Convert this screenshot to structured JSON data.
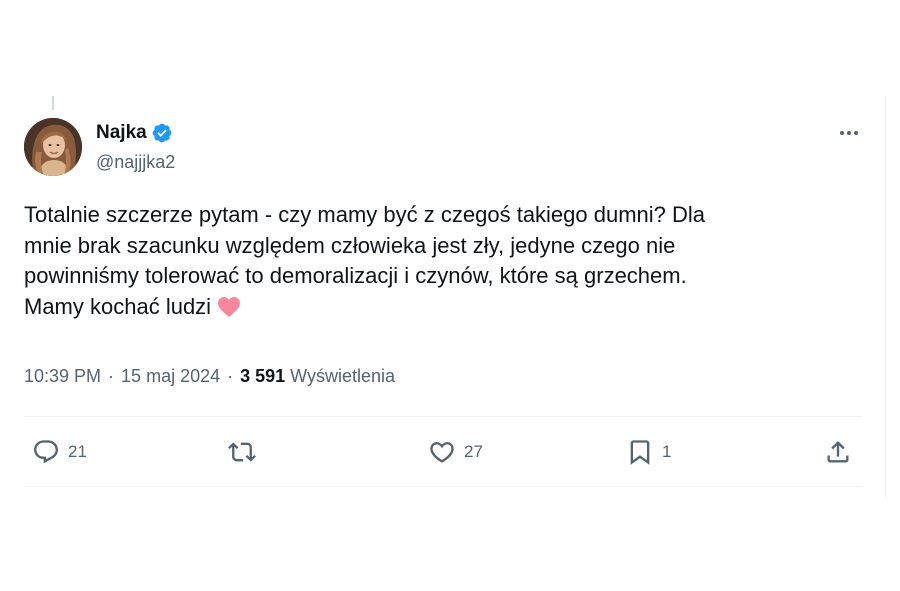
{
  "user": {
    "display_name": "Najka",
    "handle": "@najjjka2",
    "verified_color": "#1d9bf0"
  },
  "tweet": {
    "lines": [
      "Totalnie szczerze pytam - czy mamy być z czegoś takiego dumni? Dla",
      "mnie brak szacunku względem człowieka jest zły, jedyne czego nie",
      "powinniśmy tolerować to demoralizacji i czynów, które są grzechem.",
      "Mamy kochać ludzi"
    ],
    "emoji_name": "pink-heart",
    "emoji_color": "#f7879a"
  },
  "meta": {
    "time": "10:39 PM",
    "separator": "·",
    "date": "15 maj 2024",
    "views_count": "3 591",
    "views_label": "Wyświetlenia"
  },
  "actions": {
    "replies": "21",
    "retweets": "",
    "likes": "27",
    "bookmarks": "1"
  },
  "icons": {
    "reply": "reply-icon",
    "retweet": "retweet-icon",
    "like": "like-icon",
    "bookmark": "bookmark-icon",
    "share": "share-icon",
    "more": "more-icon"
  },
  "colors": {
    "text": "#0f1419",
    "secondary": "#536471",
    "divider": "#eff3f4",
    "accent": "#1d9bf0"
  }
}
